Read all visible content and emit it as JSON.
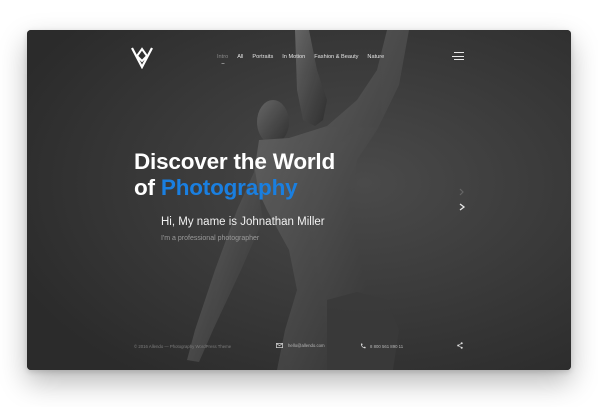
{
  "nav": {
    "items": [
      {
        "label": "Intro",
        "active": true
      },
      {
        "label": "All",
        "active": false
      },
      {
        "label": "Portraits",
        "active": false
      },
      {
        "label": "In Motion",
        "active": false
      },
      {
        "label": "Fashion & Beauty",
        "active": false
      },
      {
        "label": "Nature",
        "active": false
      }
    ]
  },
  "hero": {
    "headline_line1": "Discover the World",
    "headline_of": "of ",
    "headline_accent": "Photography",
    "intro": "Hi, My name is Johnathan Miller",
    "subtitle": "I'm a professional photographer"
  },
  "footer": {
    "copyright": "© 2016 Allendo — Photography WordPress Theme",
    "email": "hello@allendo.com",
    "phone": "8 800 561 890 11"
  },
  "icons": {
    "logo": "allendo-logo",
    "menu": "hamburger-menu-icon",
    "prev": "chevron-up-icon",
    "next": "chevron-right-icon",
    "email": "envelope-icon",
    "phone": "phone-icon",
    "share": "share-icon"
  },
  "colors": {
    "accent": "#1a7fe0",
    "background": "#2e2e2e",
    "text": "#ffffff"
  }
}
